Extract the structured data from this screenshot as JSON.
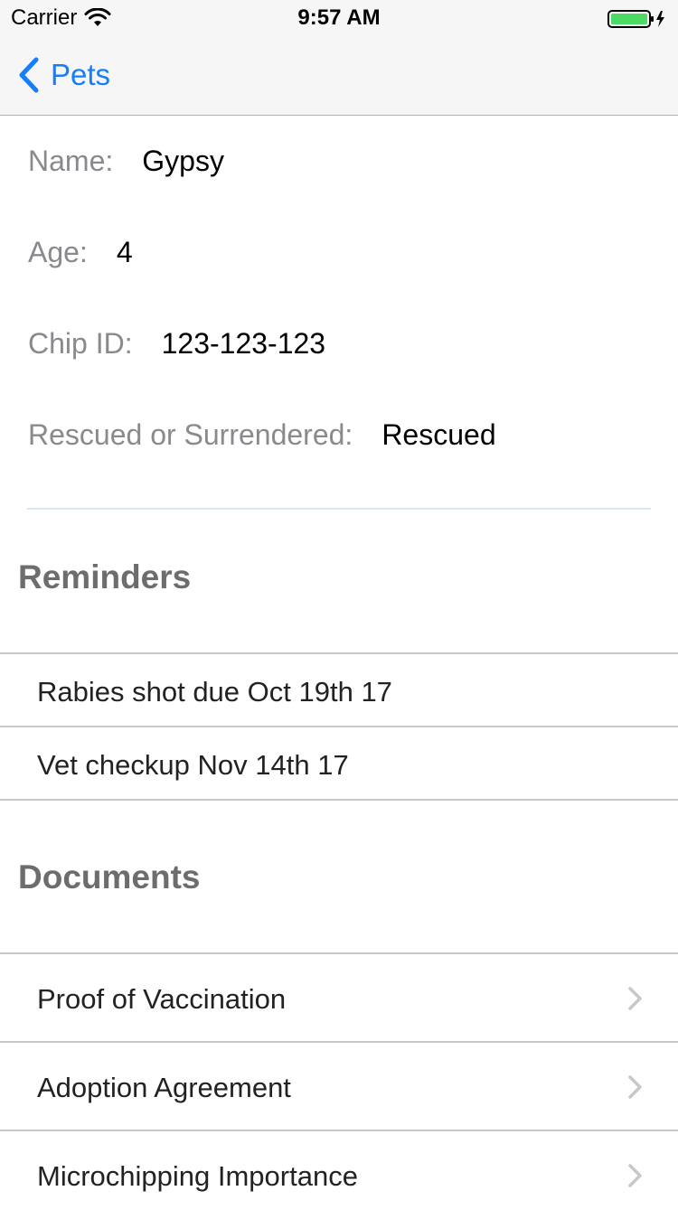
{
  "status_bar": {
    "carrier": "Carrier",
    "time": "9:57 AM",
    "battery_color": "#4cd964"
  },
  "nav": {
    "back_label": "Pets",
    "accent_color": "#157efb"
  },
  "pet": {
    "name_label": "Name:",
    "name_value": "Gypsy",
    "age_label": "Age:",
    "age_value": "4",
    "chip_label": "Chip ID:",
    "chip_value": "123-123-123",
    "rescue_label": "Rescued or Surrendered:",
    "rescue_value": "Rescued"
  },
  "reminders": {
    "title": "Reminders",
    "items": [
      {
        "label": "Rabies shot due Oct 19th 17"
      },
      {
        "label": "Vet checkup Nov 14th 17"
      }
    ]
  },
  "documents": {
    "title": "Documents",
    "items": [
      {
        "label": "Proof of Vaccination",
        "icon": "chevron-right-icon"
      },
      {
        "label": "Adoption Agreement",
        "icon": "chevron-right-icon"
      },
      {
        "label": "Microchipping Importance",
        "icon": "chevron-right-icon"
      }
    ]
  }
}
